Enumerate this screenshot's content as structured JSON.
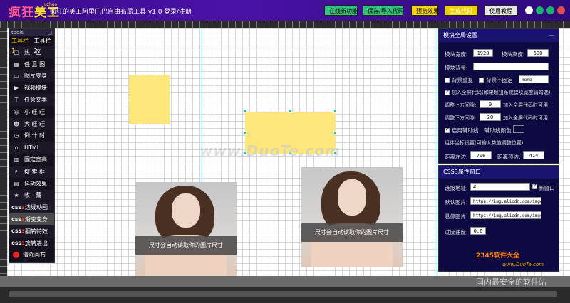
{
  "header": {
    "logo_main": "疯狂",
    "logo_accent": "美工",
    "logo_sub": "uzhuo",
    "app_title": "疯狂的美工阿里巴巴自由布局工具 v1.0",
    "login": "登录/注册",
    "buttons": {
      "online": "在线新功能",
      "save": "保存/导入代码",
      "preview": "预览效果",
      "generate": "生成代码",
      "help": "使用教程"
    }
  },
  "tools": {
    "header": "tools",
    "close": "□",
    "tab1": "工具栏1",
    "tab2": "工具栏2",
    "items": [
      {
        "icon": "▢",
        "label": "热　区"
      },
      {
        "icon": "▦",
        "label": "任 意 图"
      },
      {
        "icon": "▭",
        "label": "图片变身"
      },
      {
        "icon": "▶",
        "label": "视频模块"
      },
      {
        "icon": "T",
        "label": "任意文本"
      },
      {
        "icon": "☺",
        "label": "小 旺 旺"
      },
      {
        "icon": "☻",
        "label": "大 旺 旺"
      },
      {
        "icon": "◷",
        "label": "倒 计 时"
      },
      {
        "icon": "⌂",
        "label": "HTML"
      },
      {
        "icon": "▥",
        "label": "固定宽高"
      },
      {
        "icon": "⌕",
        "label": "搜 索 框"
      },
      {
        "icon": "▤",
        "label": "抖动效果"
      },
      {
        "icon": "★",
        "label": "收　藏"
      }
    ],
    "css3_items": [
      {
        "label": "边线动画"
      },
      {
        "label": "渐变变身"
      },
      {
        "label": "翻转特效"
      },
      {
        "label": "旋转进出"
      }
    ],
    "css3_prefix": "CSS",
    "css3_num": "3",
    "clear": "清除画布"
  },
  "canvas": {
    "photo_caption_1": "尺寸会自动读取你的图片尺寸",
    "photo_caption_2": "尺寸会自动读取你的图片尺寸",
    "watermark": "www.DuoTe.com"
  },
  "panel_global": {
    "title": "模块全局设置",
    "close": "—",
    "width_label": "模块宽度:",
    "width_value": "1920",
    "height_label": "模块高度:",
    "height_value": "600",
    "bg_label": "模块背景:",
    "bg_value": "",
    "bg_repeat": "背景重复",
    "bg_fixed": "背景不固定",
    "bg_select": "none",
    "fullscreen": "加入全屏代码(如果超出系统模块宽度请勾选)",
    "top_margin_label": "调整上方间隙:",
    "top_margin_value": "0",
    "top_margin_note": "加入全屏代码时可用!",
    "bottom_margin_label": "调整下方间隙:",
    "bottom_margin_value": "20",
    "bottom_margin_note": "加入全屏代码时可用!",
    "guide_label": "启用辅助线",
    "guide_color_label": "辅助线颜色",
    "coord_label": "组件坐标设置(可输入数值调整位置)",
    "left_label": "距离左边:",
    "left_value": "706",
    "top_label": "距离顶边:",
    "top_value": "414"
  },
  "panel_css3": {
    "title": "CSS3属性窗口",
    "link_label": "链接地址:",
    "link_value": "#",
    "new_window": "新窗口",
    "default_img_label": "默认图片:",
    "default_img_value": "https://img.alicdn.com/imgextra/",
    "hover_img_label": "悬停图片:",
    "hover_img_value": "https://img.alicdn.com/imgextra/",
    "transition_label": "过度速度:",
    "transition_value": "0.6"
  },
  "site": {
    "logo": "2345软件大全",
    "domain": "www.DuoTe.com",
    "bottom": "国内最安全的软件站"
  }
}
